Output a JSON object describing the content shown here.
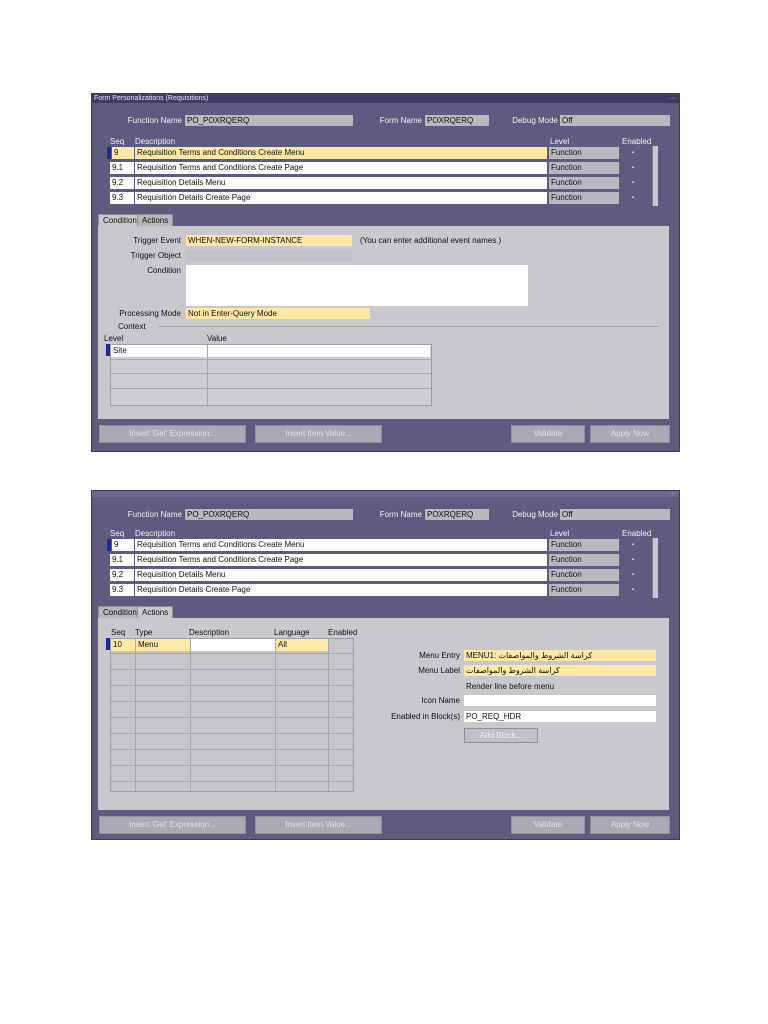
{
  "header": {
    "window_title": "Form Personalizations (Requisitions)",
    "function_name_label": "Function Name",
    "function_name_value": "PO_POXRQERQ",
    "form_name_label": "Form Name",
    "form_name_value": "POXRQERQ",
    "debug_mode_label": "Debug Mode",
    "debug_mode_value": "Off"
  },
  "table": {
    "col_seq": "Seq",
    "col_description": "Description",
    "col_level": "Level",
    "col_enabled": "Enabled",
    "rows": [
      {
        "seq": "9",
        "description": "Requisition Terms and Conditions Create Menu",
        "level": "Function"
      },
      {
        "seq": "9.1",
        "description": "Requisition Terms and Conditions Create Page",
        "level": "Function"
      },
      {
        "seq": "9.2",
        "description": "Requisition Details Menu",
        "level": "Function"
      },
      {
        "seq": "9.3",
        "description": "Requisition Details Create Page",
        "level": "Function"
      }
    ]
  },
  "tabs": {
    "condition": "Condition",
    "actions": "Actions"
  },
  "condition": {
    "trigger_event_label": "Trigger Event",
    "trigger_event_value": "WHEN-NEW-FORM-INSTANCE",
    "trigger_event_hint": "(You can enter additional event names.)",
    "trigger_object_label": "Trigger Object",
    "condition_label": "Condition",
    "processing_mode_label": "Processing Mode",
    "processing_mode_value": "Not in Enter-Query Mode",
    "context_label": "Context",
    "context_level_header": "Level",
    "context_value_header": "Value",
    "context_first_level": "Site"
  },
  "actions": {
    "col_seq": "Seq",
    "col_type": "Type",
    "col_description": "Description",
    "col_language": "Language",
    "col_enabled": "Enabled",
    "first_seq": "10",
    "first_type": "Menu",
    "first_language": "All",
    "menu_entry_label": "Menu Entry",
    "menu_entry_value": "MENU1: كراسة الشروط والمواصفات",
    "menu_label_label": "Menu Label",
    "menu_label_value": "كراسة الشروط والمواصفات",
    "render_line_label": "Render line before menu",
    "icon_name_label": "Icon Name",
    "enabled_in_blocks_label": "Enabled in Block(s)",
    "enabled_in_blocks_value": "PO_REQ_HDR",
    "add_block_button": "Add Block..."
  },
  "buttons": {
    "insert_get": "Insert 'Get' Expression...",
    "insert_item": "Insert Item Value...",
    "validate": "Validate",
    "apply_now": "Apply Now"
  },
  "colors": {
    "background": "#5f5b7e",
    "current_row": "#fde9a5",
    "panel": "#c9c8cc"
  }
}
